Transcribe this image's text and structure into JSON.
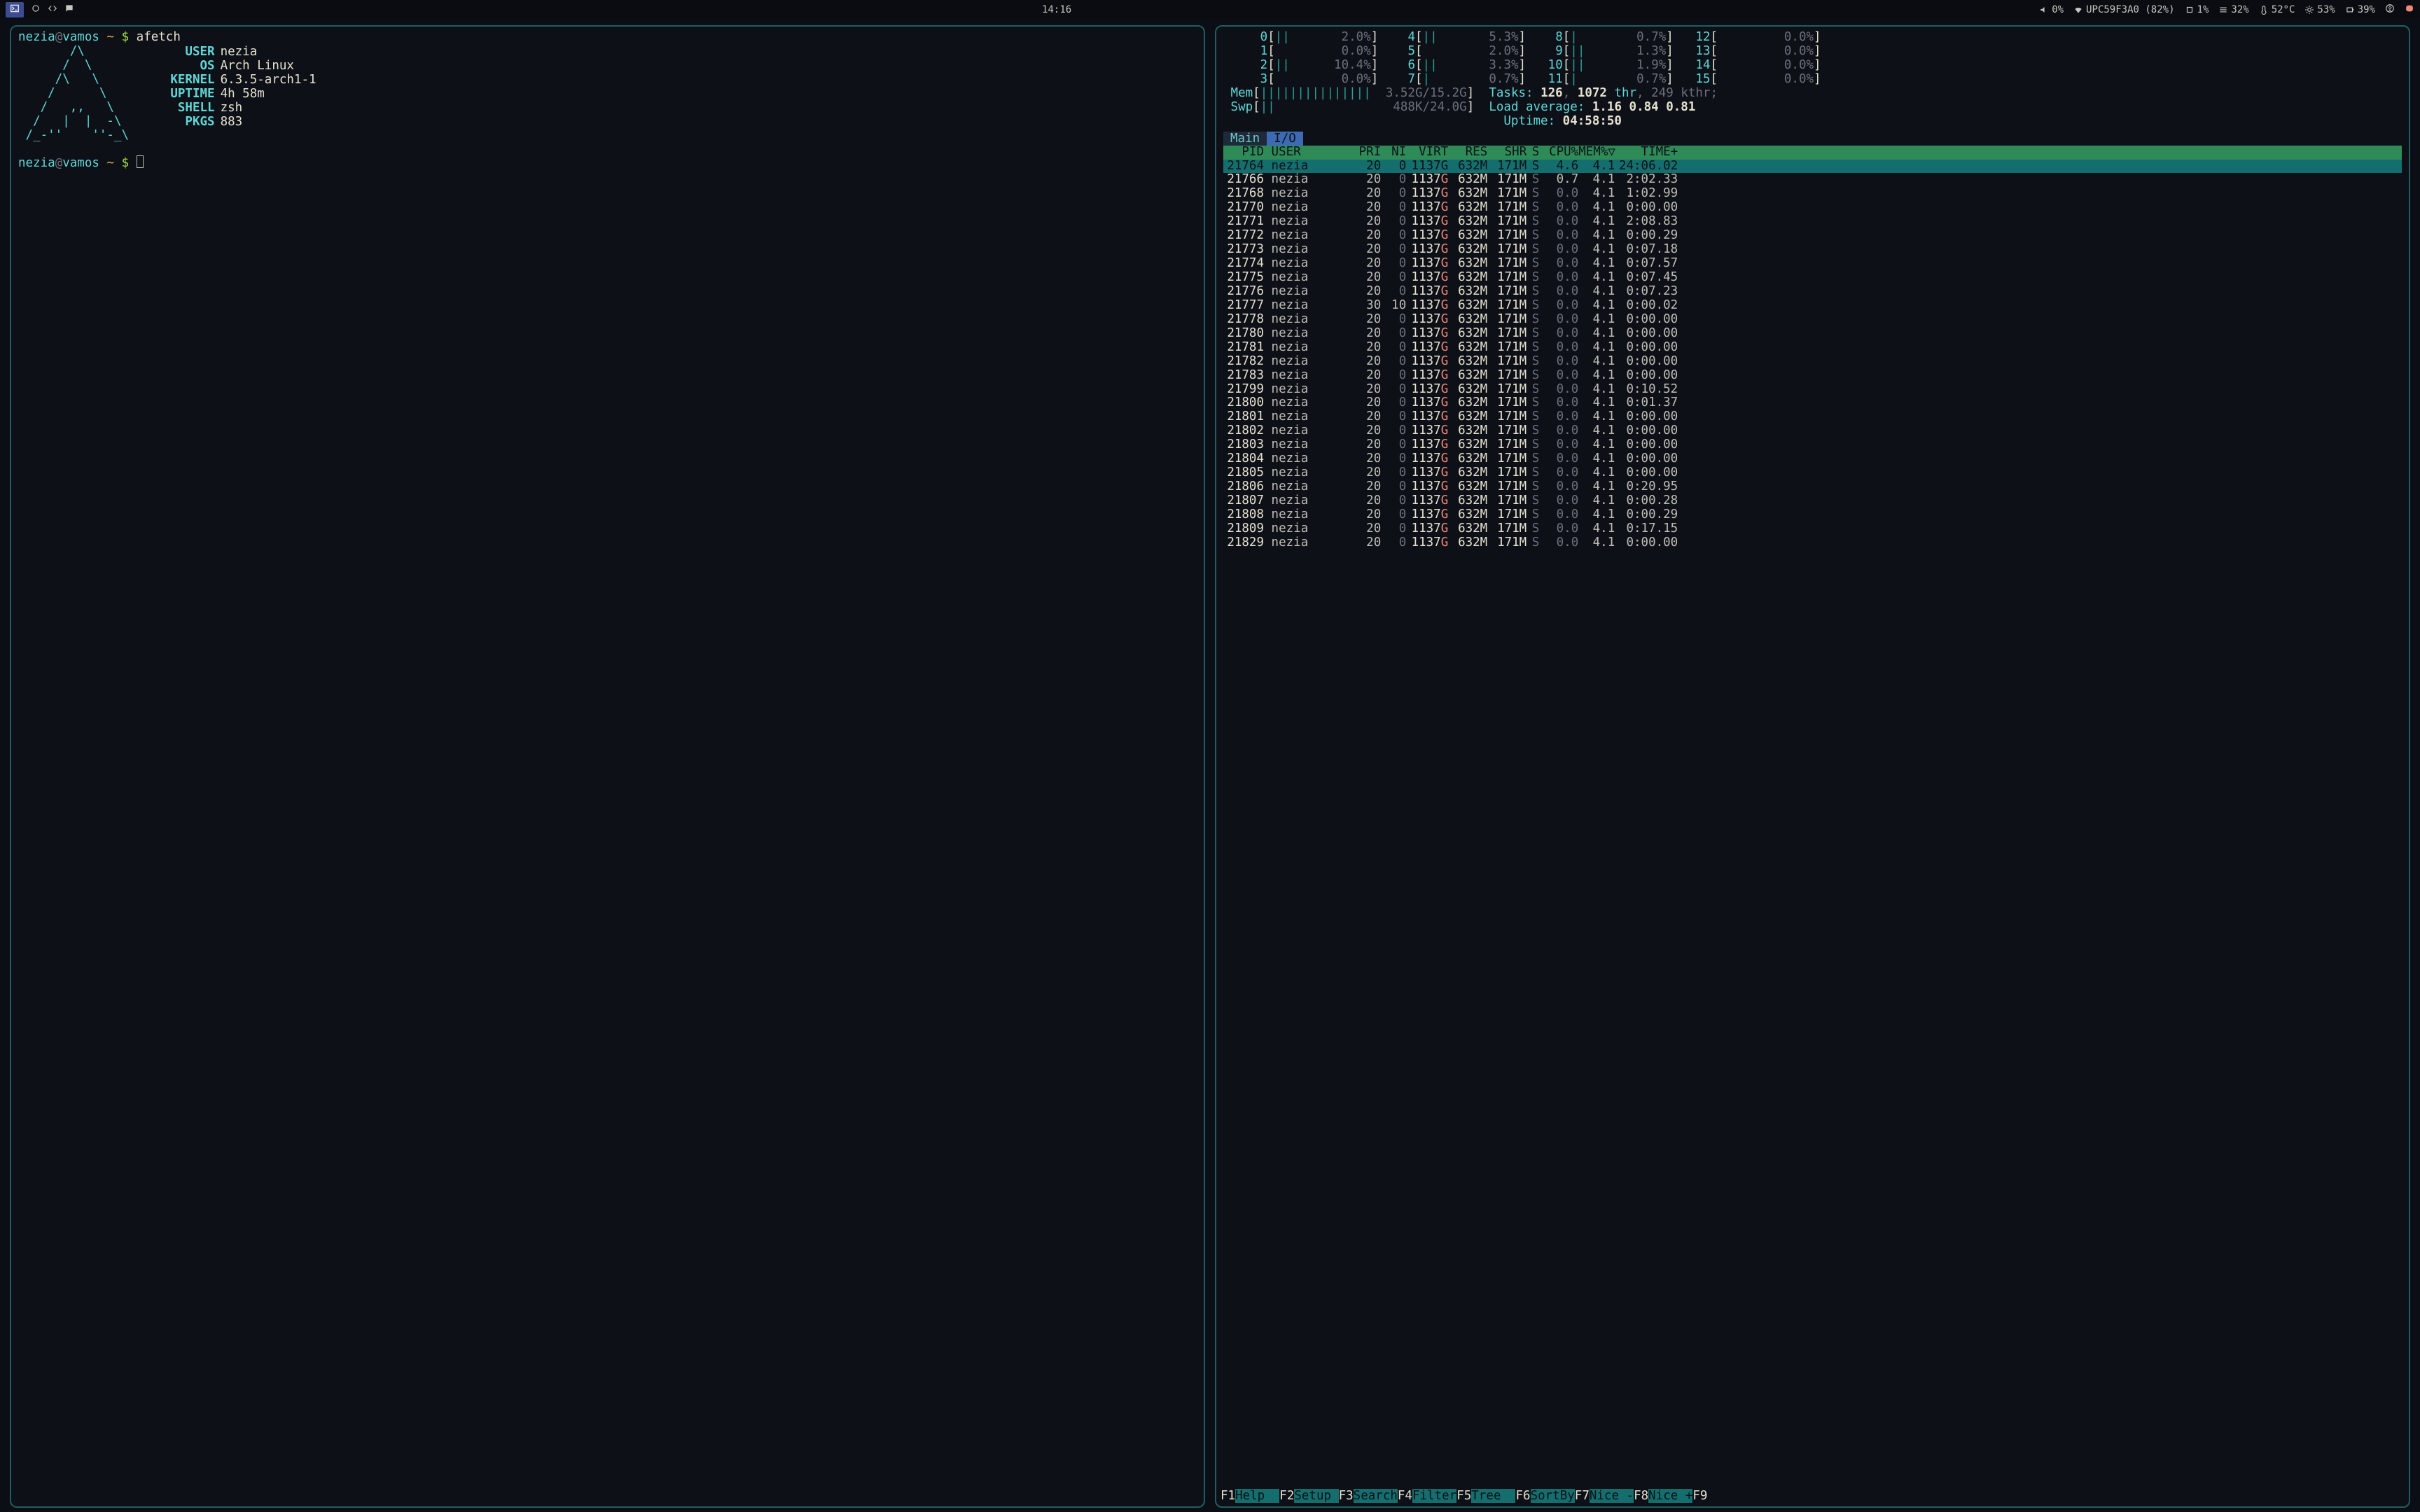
{
  "topbar": {
    "clock": "14:16",
    "volume": "0%",
    "wifi": "UPC59F3A0 (82%)",
    "cpu": "1%",
    "mem": "32%",
    "temp": "52°C",
    "fan": "53%",
    "bat": "39%"
  },
  "prompt": {
    "user": "nezia",
    "host": "vamos",
    "path": "~",
    "cmd": "afetch"
  },
  "afetch": {
    "logo": [
      "       /\\       ",
      "      /  \\      ",
      "     /\\   \\     ",
      "    /      \\    ",
      "   /   ,,   \\   ",
      "  /   |  |  -\\  ",
      " /_-''    ''-_\\ "
    ],
    "rows": [
      {
        "key": "USER",
        "val": "nezia"
      },
      {
        "key": "OS",
        "val": "Arch Linux"
      },
      {
        "key": "KERNEL",
        "val": "6.3.5-arch1-1"
      },
      {
        "key": "UPTIME",
        "val": "4h 58m"
      },
      {
        "key": "SHELL",
        "val": "zsh"
      },
      {
        "key": "PKGS",
        "val": "883"
      }
    ]
  },
  "htop": {
    "cpus": [
      {
        "n": "0",
        "bar": "||",
        "pct": "2.0%"
      },
      {
        "n": "1",
        "bar": "",
        "pct": "0.0%"
      },
      {
        "n": "2",
        "bar": "||",
        "pct": "10.4%"
      },
      {
        "n": "3",
        "bar": "",
        "pct": "0.0%"
      },
      {
        "n": "4",
        "bar": "||",
        "pct": "5.3%"
      },
      {
        "n": "5",
        "bar": "",
        "pct": "2.0%"
      },
      {
        "n": "6",
        "bar": "||",
        "pct": "3.3%"
      },
      {
        "n": "7",
        "bar": "|",
        "pct": "0.7%"
      },
      {
        "n": "8",
        "bar": "|",
        "pct": "0.7%"
      },
      {
        "n": "9",
        "bar": "||",
        "pct": "1.3%"
      },
      {
        "n": "10",
        "bar": "||",
        "pct": "1.9%"
      },
      {
        "n": "11",
        "bar": "|",
        "pct": "0.7%"
      },
      {
        "n": "12",
        "bar": "",
        "pct": "0.0%"
      },
      {
        "n": "13",
        "bar": "",
        "pct": "0.0%"
      },
      {
        "n": "14",
        "bar": "",
        "pct": "0.0%"
      },
      {
        "n": "15",
        "bar": "",
        "pct": "0.0%"
      }
    ],
    "mem": {
      "bar": "|||||||||||||||",
      "text": "3.52G/15.2G"
    },
    "swp": {
      "bar": "||",
      "text": "488K/24.0G"
    },
    "tasks": {
      "procs": "126",
      "thr": "1072",
      "kthr": "249"
    },
    "load": "1.16 0.84 0.81",
    "uptime": "04:58:50",
    "tabs": {
      "main": "Main",
      "io": "I/O"
    },
    "columns": [
      "PID",
      "USER",
      "PRI",
      "NI",
      "VIRT",
      "RES",
      "SHR",
      "S",
      "CPU%",
      "MEM%▽",
      "TIME+"
    ],
    "procs": [
      {
        "pid": "21764",
        "user": "nezia",
        "pri": "20",
        "ni": "0",
        "virt": "1137G",
        "res": "632M",
        "shr": "171M",
        "s": "S",
        "cpu": "4.6",
        "mem": "4.1",
        "time": "24:06.02",
        "hl": true
      },
      {
        "pid": "21766",
        "user": "nezia",
        "pri": "20",
        "ni": "0",
        "virt": "1137G",
        "res": "632M",
        "shr": "171M",
        "s": "S",
        "cpu": "0.7",
        "mem": "4.1",
        "time": "2:02.33"
      },
      {
        "pid": "21768",
        "user": "nezia",
        "pri": "20",
        "ni": "0",
        "virt": "1137G",
        "res": "632M",
        "shr": "171M",
        "s": "S",
        "cpu": "0.0",
        "mem": "4.1",
        "time": "1:02.99"
      },
      {
        "pid": "21770",
        "user": "nezia",
        "pri": "20",
        "ni": "0",
        "virt": "1137G",
        "res": "632M",
        "shr": "171M",
        "s": "S",
        "cpu": "0.0",
        "mem": "4.1",
        "time": "0:00.00"
      },
      {
        "pid": "21771",
        "user": "nezia",
        "pri": "20",
        "ni": "0",
        "virt": "1137G",
        "res": "632M",
        "shr": "171M",
        "s": "S",
        "cpu": "0.0",
        "mem": "4.1",
        "time": "2:08.83"
      },
      {
        "pid": "21772",
        "user": "nezia",
        "pri": "20",
        "ni": "0",
        "virt": "1137G",
        "res": "632M",
        "shr": "171M",
        "s": "S",
        "cpu": "0.0",
        "mem": "4.1",
        "time": "0:00.29"
      },
      {
        "pid": "21773",
        "user": "nezia",
        "pri": "20",
        "ni": "0",
        "virt": "1137G",
        "res": "632M",
        "shr": "171M",
        "s": "S",
        "cpu": "0.0",
        "mem": "4.1",
        "time": "0:07.18"
      },
      {
        "pid": "21774",
        "user": "nezia",
        "pri": "20",
        "ni": "0",
        "virt": "1137G",
        "res": "632M",
        "shr": "171M",
        "s": "S",
        "cpu": "0.0",
        "mem": "4.1",
        "time": "0:07.57"
      },
      {
        "pid": "21775",
        "user": "nezia",
        "pri": "20",
        "ni": "0",
        "virt": "1137G",
        "res": "632M",
        "shr": "171M",
        "s": "S",
        "cpu": "0.0",
        "mem": "4.1",
        "time": "0:07.45"
      },
      {
        "pid": "21776",
        "user": "nezia",
        "pri": "20",
        "ni": "0",
        "virt": "1137G",
        "res": "632M",
        "shr": "171M",
        "s": "S",
        "cpu": "0.0",
        "mem": "4.1",
        "time": "0:07.23"
      },
      {
        "pid": "21777",
        "user": "nezia",
        "pri": "30",
        "ni": "10",
        "virt": "1137G",
        "res": "632M",
        "shr": "171M",
        "s": "S",
        "cpu": "0.0",
        "mem": "4.1",
        "time": "0:00.02"
      },
      {
        "pid": "21778",
        "user": "nezia",
        "pri": "20",
        "ni": "0",
        "virt": "1137G",
        "res": "632M",
        "shr": "171M",
        "s": "S",
        "cpu": "0.0",
        "mem": "4.1",
        "time": "0:00.00"
      },
      {
        "pid": "21780",
        "user": "nezia",
        "pri": "20",
        "ni": "0",
        "virt": "1137G",
        "res": "632M",
        "shr": "171M",
        "s": "S",
        "cpu": "0.0",
        "mem": "4.1",
        "time": "0:00.00"
      },
      {
        "pid": "21781",
        "user": "nezia",
        "pri": "20",
        "ni": "0",
        "virt": "1137G",
        "res": "632M",
        "shr": "171M",
        "s": "S",
        "cpu": "0.0",
        "mem": "4.1",
        "time": "0:00.00"
      },
      {
        "pid": "21782",
        "user": "nezia",
        "pri": "20",
        "ni": "0",
        "virt": "1137G",
        "res": "632M",
        "shr": "171M",
        "s": "S",
        "cpu": "0.0",
        "mem": "4.1",
        "time": "0:00.00"
      },
      {
        "pid": "21783",
        "user": "nezia",
        "pri": "20",
        "ni": "0",
        "virt": "1137G",
        "res": "632M",
        "shr": "171M",
        "s": "S",
        "cpu": "0.0",
        "mem": "4.1",
        "time": "0:00.00"
      },
      {
        "pid": "21799",
        "user": "nezia",
        "pri": "20",
        "ni": "0",
        "virt": "1137G",
        "res": "632M",
        "shr": "171M",
        "s": "S",
        "cpu": "0.0",
        "mem": "4.1",
        "time": "0:10.52"
      },
      {
        "pid": "21800",
        "user": "nezia",
        "pri": "20",
        "ni": "0",
        "virt": "1137G",
        "res": "632M",
        "shr": "171M",
        "s": "S",
        "cpu": "0.0",
        "mem": "4.1",
        "time": "0:01.37"
      },
      {
        "pid": "21801",
        "user": "nezia",
        "pri": "20",
        "ni": "0",
        "virt": "1137G",
        "res": "632M",
        "shr": "171M",
        "s": "S",
        "cpu": "0.0",
        "mem": "4.1",
        "time": "0:00.00"
      },
      {
        "pid": "21802",
        "user": "nezia",
        "pri": "20",
        "ni": "0",
        "virt": "1137G",
        "res": "632M",
        "shr": "171M",
        "s": "S",
        "cpu": "0.0",
        "mem": "4.1",
        "time": "0:00.00"
      },
      {
        "pid": "21803",
        "user": "nezia",
        "pri": "20",
        "ni": "0",
        "virt": "1137G",
        "res": "632M",
        "shr": "171M",
        "s": "S",
        "cpu": "0.0",
        "mem": "4.1",
        "time": "0:00.00"
      },
      {
        "pid": "21804",
        "user": "nezia",
        "pri": "20",
        "ni": "0",
        "virt": "1137G",
        "res": "632M",
        "shr": "171M",
        "s": "S",
        "cpu": "0.0",
        "mem": "4.1",
        "time": "0:00.00"
      },
      {
        "pid": "21805",
        "user": "nezia",
        "pri": "20",
        "ni": "0",
        "virt": "1137G",
        "res": "632M",
        "shr": "171M",
        "s": "S",
        "cpu": "0.0",
        "mem": "4.1",
        "time": "0:00.00"
      },
      {
        "pid": "21806",
        "user": "nezia",
        "pri": "20",
        "ni": "0",
        "virt": "1137G",
        "res": "632M",
        "shr": "171M",
        "s": "S",
        "cpu": "0.0",
        "mem": "4.1",
        "time": "0:20.95"
      },
      {
        "pid": "21807",
        "user": "nezia",
        "pri": "20",
        "ni": "0",
        "virt": "1137G",
        "res": "632M",
        "shr": "171M",
        "s": "S",
        "cpu": "0.0",
        "mem": "4.1",
        "time": "0:00.28"
      },
      {
        "pid": "21808",
        "user": "nezia",
        "pri": "20",
        "ni": "0",
        "virt": "1137G",
        "res": "632M",
        "shr": "171M",
        "s": "S",
        "cpu": "0.0",
        "mem": "4.1",
        "time": "0:00.29"
      },
      {
        "pid": "21809",
        "user": "nezia",
        "pri": "20",
        "ni": "0",
        "virt": "1137G",
        "res": "632M",
        "shr": "171M",
        "s": "S",
        "cpu": "0.0",
        "mem": "4.1",
        "time": "0:17.15"
      },
      {
        "pid": "21829",
        "user": "nezia",
        "pri": "20",
        "ni": "0",
        "virt": "1137G",
        "res": "632M",
        "shr": "171M",
        "s": "S",
        "cpu": "0.0",
        "mem": "4.1",
        "time": "0:00.00"
      }
    ],
    "fkeys": [
      {
        "k": "F1",
        "l": "Help  "
      },
      {
        "k": "F2",
        "l": "Setup "
      },
      {
        "k": "F3",
        "l": "Search"
      },
      {
        "k": "F4",
        "l": "Filter"
      },
      {
        "k": "F5",
        "l": "Tree  "
      },
      {
        "k": "F6",
        "l": "SortBy"
      },
      {
        "k": "F7",
        "l": "Nice -"
      },
      {
        "k": "F8",
        "l": "Nice +"
      },
      {
        "k": "F9",
        "l": ""
      }
    ]
  }
}
